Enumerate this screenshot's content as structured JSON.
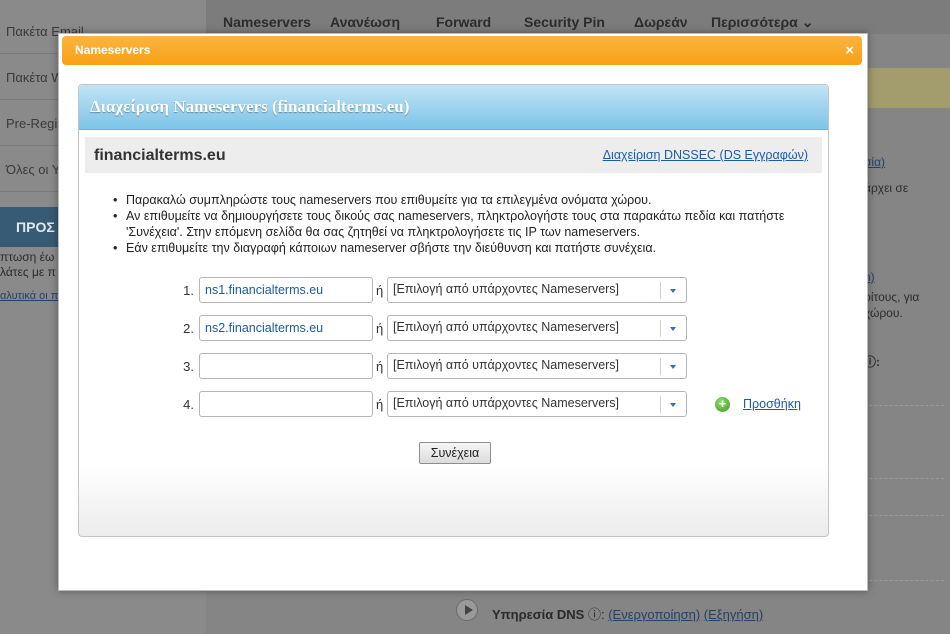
{
  "background": {
    "sidebar_items": [
      "Πακέτα Email",
      "Πακέτα W",
      "Pre-Regis",
      "Όλες οι Υ"
    ],
    "promo_heading": "ΠΡΟΣ",
    "promo_text": [
      "πτωση έω",
      "λάτες με π"
    ],
    "promo_link": "αλυτικά οι π",
    "top_nav": [
      "Nameservers",
      "Ανανέωση",
      "Forward",
      "Security Pin",
      "Δωρεάν",
      "Περισσότερα"
    ],
    "right_fragments": {
      "link1": "σία)",
      "text1": "άρχει σε",
      "link2": "n)",
      "text2a": "ρίτους, για",
      "text2b": "χώρου.",
      "label3": ":"
    },
    "bottom_row": {
      "label": "Υπηρεσία DNS",
      "activate_link": "(Ενεργοποίηση)",
      "explain_link": "(Εξηγήση)"
    }
  },
  "modal": {
    "title": "Nameservers",
    "close_glyph": "×",
    "panel_title": "Διαχείριση Nameservers (financialterms.eu)",
    "domain": "financialterms.eu",
    "dnssec_link": "Διαχείριση DNSSEC (DS Εγγραφών)",
    "instructions": [
      "Παρακαλώ συμπληρώστε τους nameservers που επιθυμείτε για τα επιλεγμένα ονόματα χώρου.",
      "Αν επιθυμείτε να δημιουργήσετε τους δικούς σας nameservers, πληκτρολογήστε τους στα παρακάτω πεδία και πατήστε 'Συνέχεια'. Στην επόμενη σελίδα θα σας ζητηθεί να πληκτρολογήσετε τις IP των nameservers.",
      "Εάν επιθυμείτε την διαγραφή κάποιων nameserver σβήστε την διεύθυνση και πατήστε συνέχεια."
    ],
    "or_label": "ή",
    "select_placeholder": "[Επιλογή από υπάρχοντες Nameservers]",
    "rows": [
      {
        "num": "1.",
        "value": "ns1.financialterms.eu"
      },
      {
        "num": "2.",
        "value": "ns2.financialterms.eu"
      },
      {
        "num": "3.",
        "value": ""
      },
      {
        "num": "4.",
        "value": ""
      }
    ],
    "add_label": "Προσθήκη",
    "continue_label": "Συνέχεια"
  }
}
